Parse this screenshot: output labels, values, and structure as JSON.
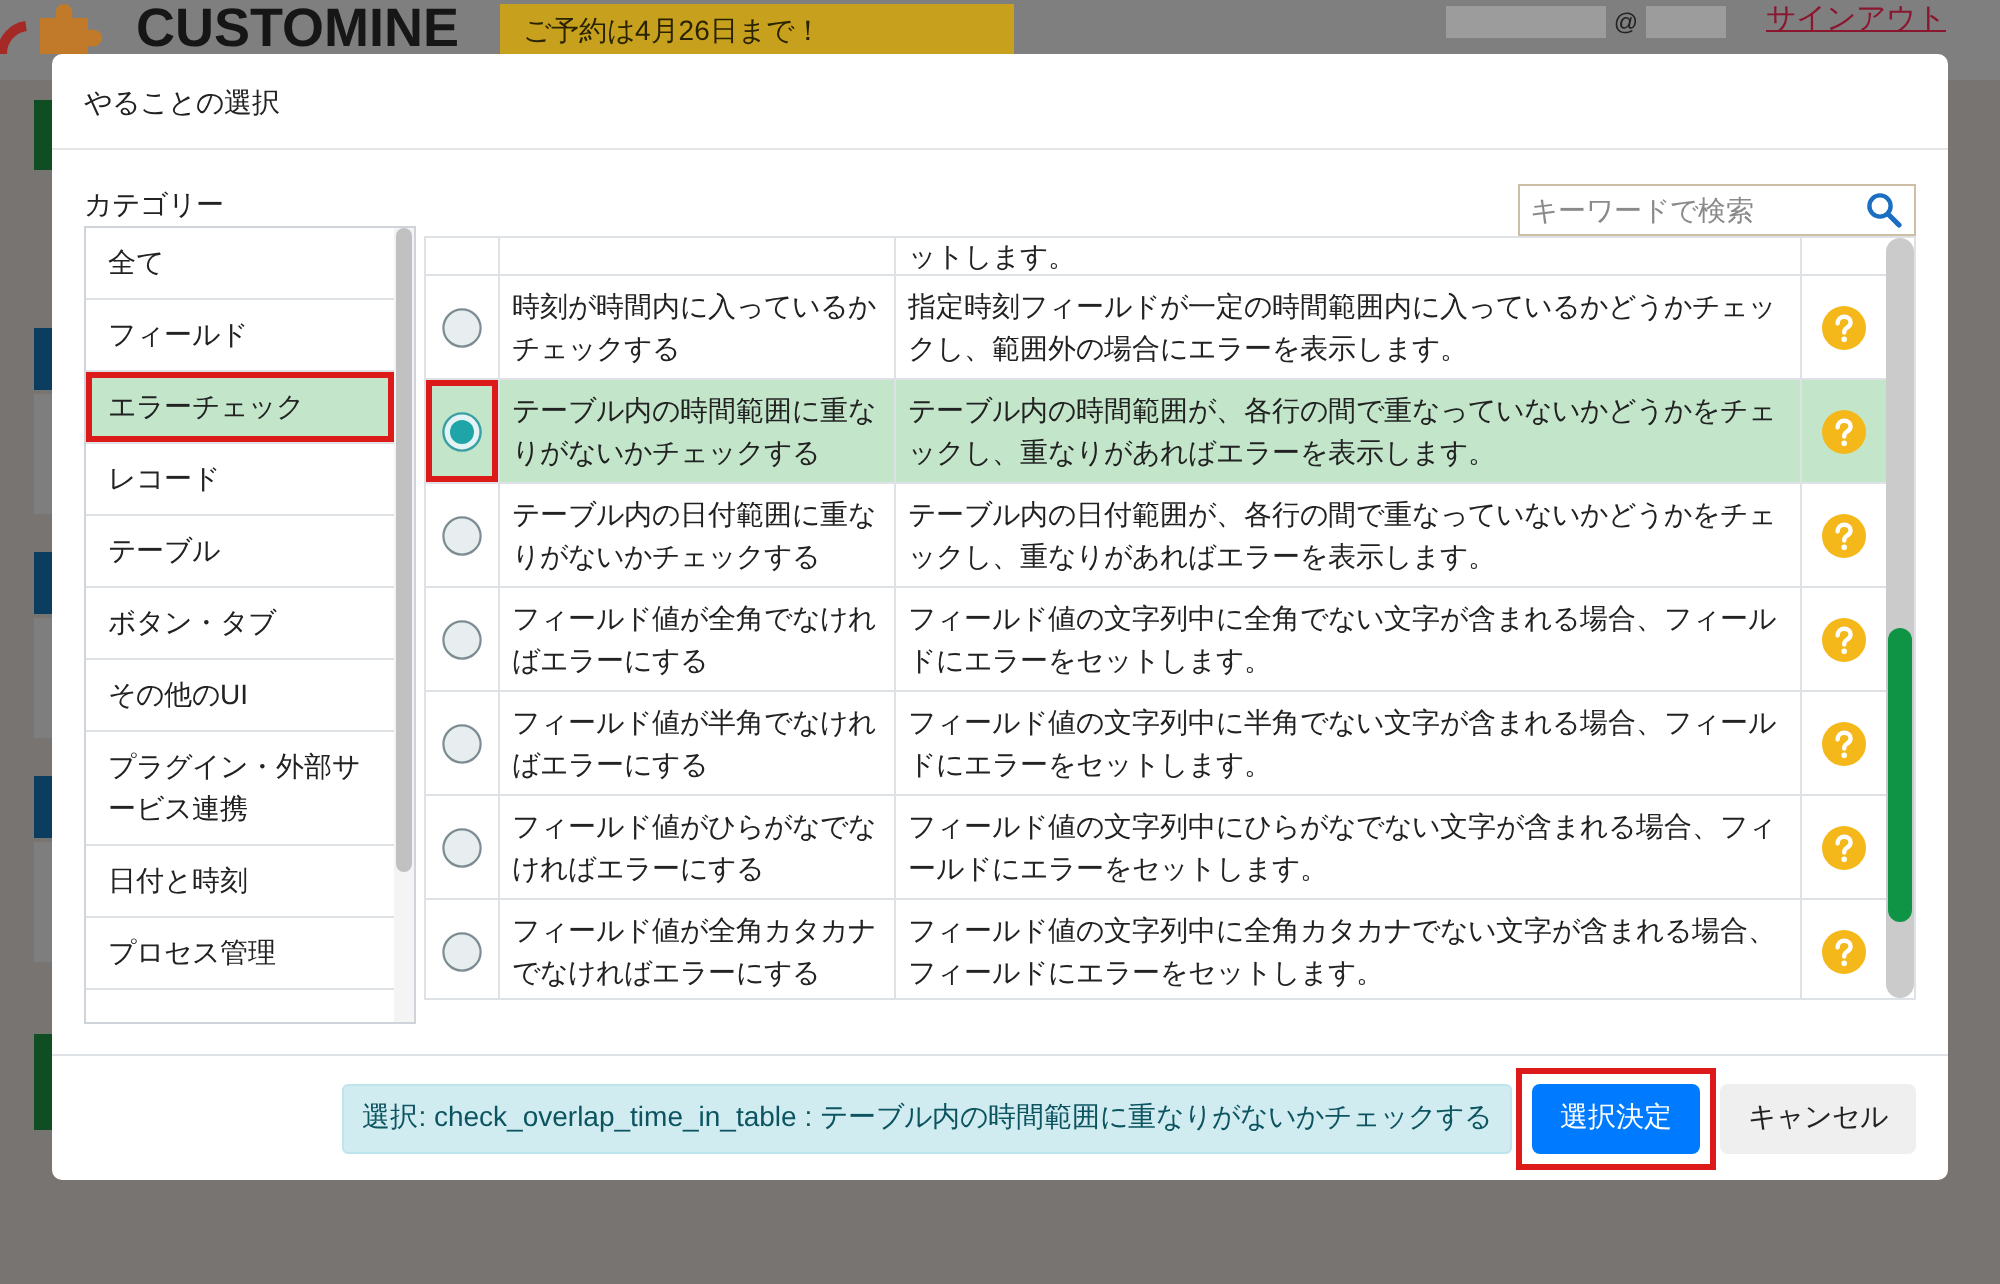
{
  "page": {
    "logo_text": "CUSTOMINE",
    "banner": "ご予約は4月26日まで！",
    "email_at": "@",
    "sign_out": "サインアウト"
  },
  "dialog": {
    "title": "やることの選択",
    "category_label": "カテゴリー",
    "categories": [
      {
        "label": "全て",
        "selected": false,
        "highlighted": false
      },
      {
        "label": "フィールド",
        "selected": false,
        "highlighted": false
      },
      {
        "label": "エラーチェック",
        "selected": true,
        "highlighted": true
      },
      {
        "label": "レコード",
        "selected": false,
        "highlighted": false
      },
      {
        "label": "テーブル",
        "selected": false,
        "highlighted": false
      },
      {
        "label": "ボタン・タブ",
        "selected": false,
        "highlighted": false
      },
      {
        "label": "その他のUI",
        "selected": false,
        "highlighted": false
      },
      {
        "label": "プラグイン・外部サービス連携",
        "selected": false,
        "highlighted": false
      },
      {
        "label": "日付と時刻",
        "selected": false,
        "highlighted": false
      },
      {
        "label": "プロセス管理",
        "selected": false,
        "highlighted": false
      }
    ],
    "search": {
      "placeholder": "キーワードで検索"
    },
    "cut_row": {
      "description": "ットします。"
    },
    "actions": [
      {
        "name": "時刻が時間内に入っているかチェックする",
        "description": "指定時刻フィールドが一定の時間範囲内に入っているかどうかチェックし、範囲外の場合にエラーを表示します。",
        "selected": false,
        "highlighted": false
      },
      {
        "name": "テーブル内の時間範囲に重なりがないかチェックする",
        "description": "テーブル内の時間範囲が、各行の間で重なっていないかどうかをチェックし、重なりがあればエラーを表示します。",
        "selected": true,
        "highlighted": true
      },
      {
        "name": "テーブル内の日付範囲に重なりがないかチェックする",
        "description": "テーブル内の日付範囲が、各行の間で重なっていないかどうかをチェックし、重なりがあればエラーを表示します。",
        "selected": false,
        "highlighted": false
      },
      {
        "name": "フィールド値が全角でなければエラーにする",
        "description": "フィールド値の文字列中に全角でない文字が含まれる場合、フィールドにエラーをセットします。",
        "selected": false,
        "highlighted": false
      },
      {
        "name": "フィールド値が半角でなければエラーにする",
        "description": "フィールド値の文字列中に半角でない文字が含まれる場合、フィールドにエラーをセットします。",
        "selected": false,
        "highlighted": false
      },
      {
        "name": "フィールド値がひらがなでなければエラーにする",
        "description": "フィールド値の文字列中にひらがなでない文字が含まれる場合、フィールドにエラーをセットします。",
        "selected": false,
        "highlighted": false
      },
      {
        "name": "フィールド値が全角カタカナでなければエラーにする",
        "description": "フィールド値の文字列中に全角カタカナでない文字が含まれる場合、フィールドにエラーをセットします。",
        "selected": false,
        "highlighted": false
      }
    ],
    "selection": "選択: check_overlap_time_in_table : テーブル内の時間範囲に重なりがないかチェックする",
    "buttons": [
      {
        "label": "選択決定",
        "kind": "primary",
        "highlighted": true
      },
      {
        "label": "キャンセル",
        "kind": "secondary",
        "highlighted": false
      }
    ]
  }
}
